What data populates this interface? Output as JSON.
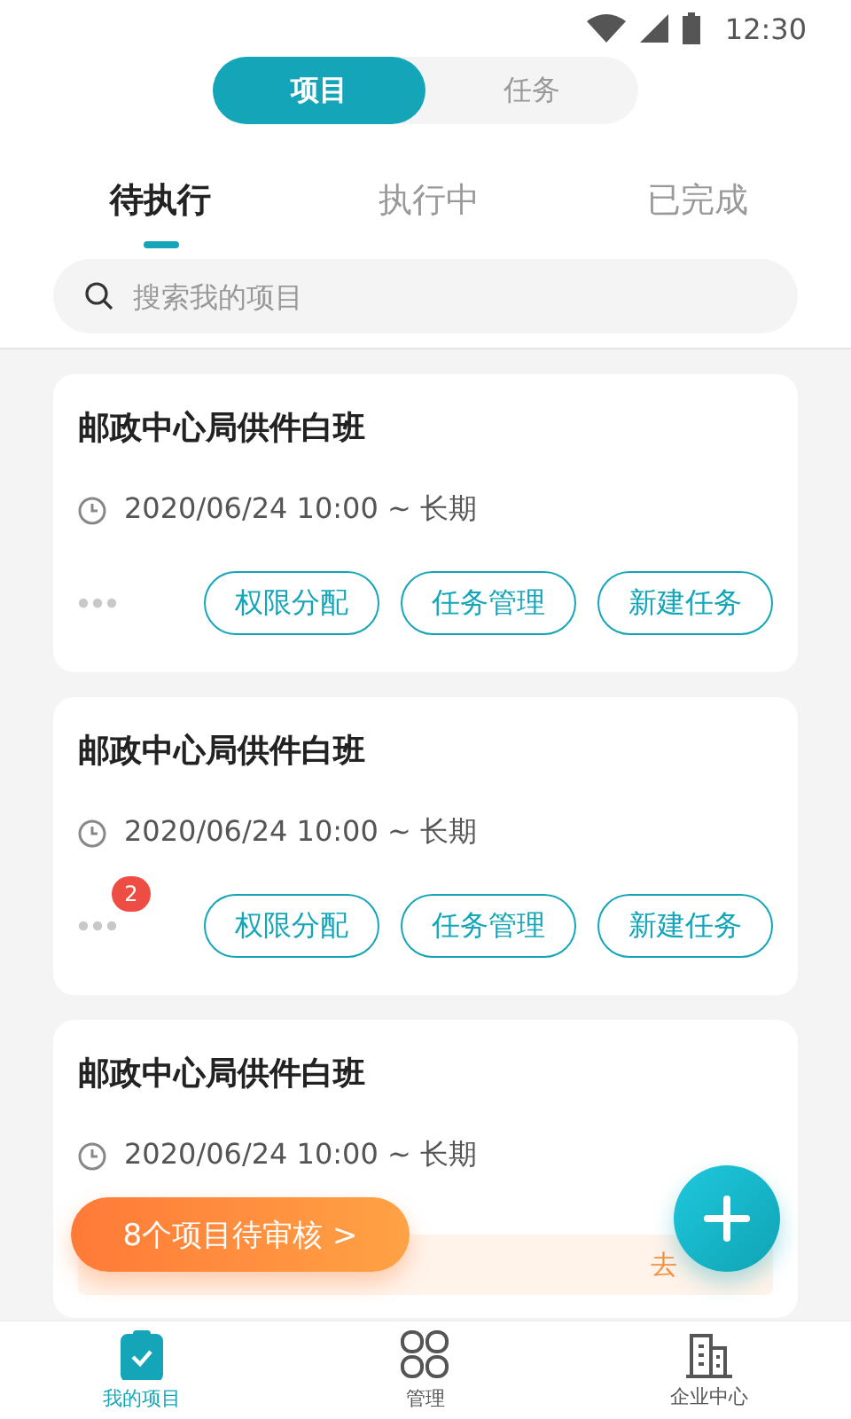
{
  "status_bar": {
    "time": "12:30"
  },
  "segments": [
    {
      "label": "项目",
      "selected": true
    },
    {
      "label": "任务",
      "selected": false
    }
  ],
  "tabs": [
    {
      "label": "待执行",
      "selected": true
    },
    {
      "label": "执行中",
      "selected": false
    },
    {
      "label": "已完成",
      "selected": false
    }
  ],
  "search": {
    "placeholder": "搜索我的项目"
  },
  "projects": [
    {
      "title": "邮政中心局供件白班",
      "time": "2020/06/24 10:00 ~ 长期",
      "actions": [
        "权限分配",
        "任务管理",
        "新建任务"
      ]
    },
    {
      "title": "邮政中心局供件白班",
      "time": "2020/06/24 10:00 ~ 长期",
      "badge": "2",
      "actions": [
        "权限分配",
        "任务管理",
        "新建任务"
      ]
    },
    {
      "title": "邮政中心局供件白班",
      "time": "2020/06/24 10:00 ~ 长期"
    }
  ],
  "review_strip": {
    "link": "去"
  },
  "pending_button": {
    "label": "8个项目待审核 >"
  },
  "bottom_nav": [
    {
      "label": "我的项目",
      "kind": "projects",
      "selected": true
    },
    {
      "label": "管理",
      "kind": "manage",
      "selected": false
    },
    {
      "label": "企业中心",
      "kind": "company",
      "selected": false
    }
  ]
}
